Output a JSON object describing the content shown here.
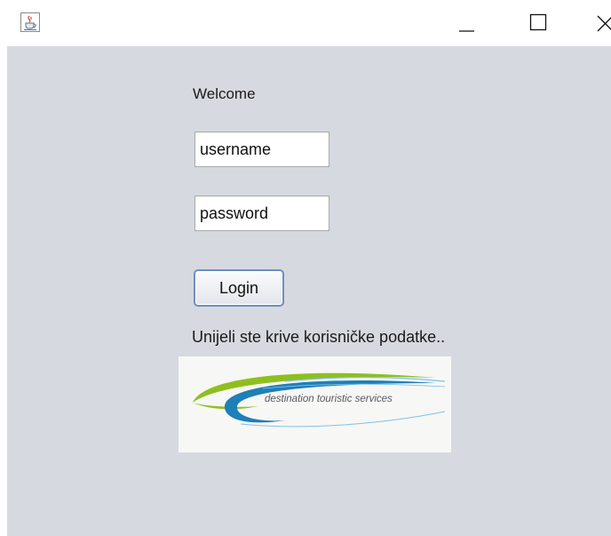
{
  "window": {
    "icon": "java-cup-icon",
    "controls": {
      "minimize_icon": "minimize-icon",
      "maximize_icon": "maximize-icon",
      "close_icon": "close-icon"
    }
  },
  "form": {
    "welcome": "Welcome",
    "username_value": "username",
    "password_value": "password",
    "login_label": "Login",
    "error_message": "Unijeli ste krive korisničke podatke.."
  },
  "logo": {
    "text": "destination touristic services",
    "colors": {
      "green": "#8fbf1e",
      "blue": "#1f7fb8",
      "light_blue": "#7ec3e6"
    }
  },
  "colors": {
    "panel_background": "#d6d9df",
    "button_border": "#6d8fc2"
  }
}
